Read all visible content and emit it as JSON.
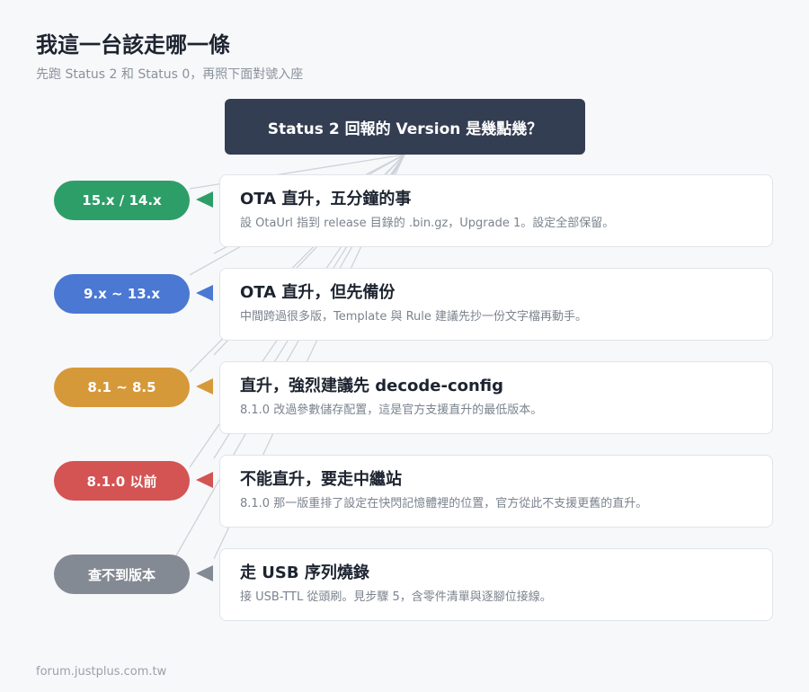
{
  "header": {
    "title": "我這一台該走哪一條",
    "subtitle": "先跑 Status 2 和 Status 0，再照下面對號入座"
  },
  "question": "Status 2 回報的 Version 是幾點幾？",
  "branches": [
    {
      "label": "15.x / 14.x",
      "color": "#2e9e68",
      "title": "OTA 直升，五分鐘的事",
      "desc": "設 OtaUrl 指到 release 目錄的 .bin.gz，Upgrade 1。設定全部保留。"
    },
    {
      "label": "9.x ~ 13.x",
      "color": "#4a78d2",
      "title": "OTA 直升，但先備份",
      "desc": "中間跨過很多版，Template 與 Rule 建議先抄一份文字檔再動手。"
    },
    {
      "label": "8.1 ~ 8.5",
      "color": "#d6993a",
      "title": "直升，強烈建議先 decode-config",
      "desc": "8.1.0 改過參數儲存配置，這是官方支援直升的最低版本。"
    },
    {
      "label": "8.1.0 以前",
      "color": "#d45353",
      "title": "不能直升，要走中繼站",
      "desc": "8.1.0 那一版重排了設定在快閃記憶體裡的位置，官方從此不支援更舊的直升。"
    },
    {
      "label": "查不到版本",
      "color": "#848a94",
      "title": "走 USB 序列燒錄",
      "desc": "接 USB-TTL 從頭刷。見步驟 5，含零件清單與逐腳位接線。"
    }
  ],
  "footer": "forum.justplus.com.tw"
}
